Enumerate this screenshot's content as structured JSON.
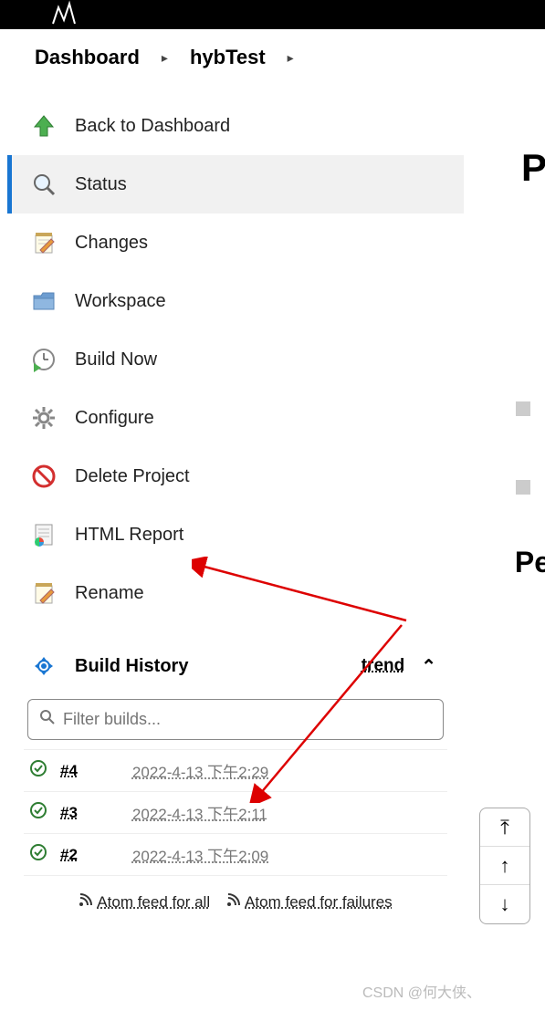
{
  "breadcrumb": {
    "root": "Dashboard",
    "project": "hybTest"
  },
  "nav": {
    "back": "Back to Dashboard",
    "status": "Status",
    "changes": "Changes",
    "workspace": "Workspace",
    "build_now": "Build Now",
    "configure": "Configure",
    "delete": "Delete Project",
    "html_report": "HTML Report",
    "rename": "Rename"
  },
  "build_history": {
    "title": "Build History",
    "trend": "trend",
    "filter_placeholder": "Filter builds...",
    "rows": [
      {
        "num": "#4",
        "date": "2022-4-13 下午2:29"
      },
      {
        "num": "#3",
        "date": "2022-4-13 下午2:11"
      },
      {
        "num": "#2",
        "date": "2022-4-13 下午2:09"
      }
    ],
    "feed_all": "Atom feed for all",
    "feed_fail": "Atom feed for failures"
  },
  "right_peek1": "P",
  "right_peek2": "Pe",
  "watermark": "CSDN @何大侠、"
}
